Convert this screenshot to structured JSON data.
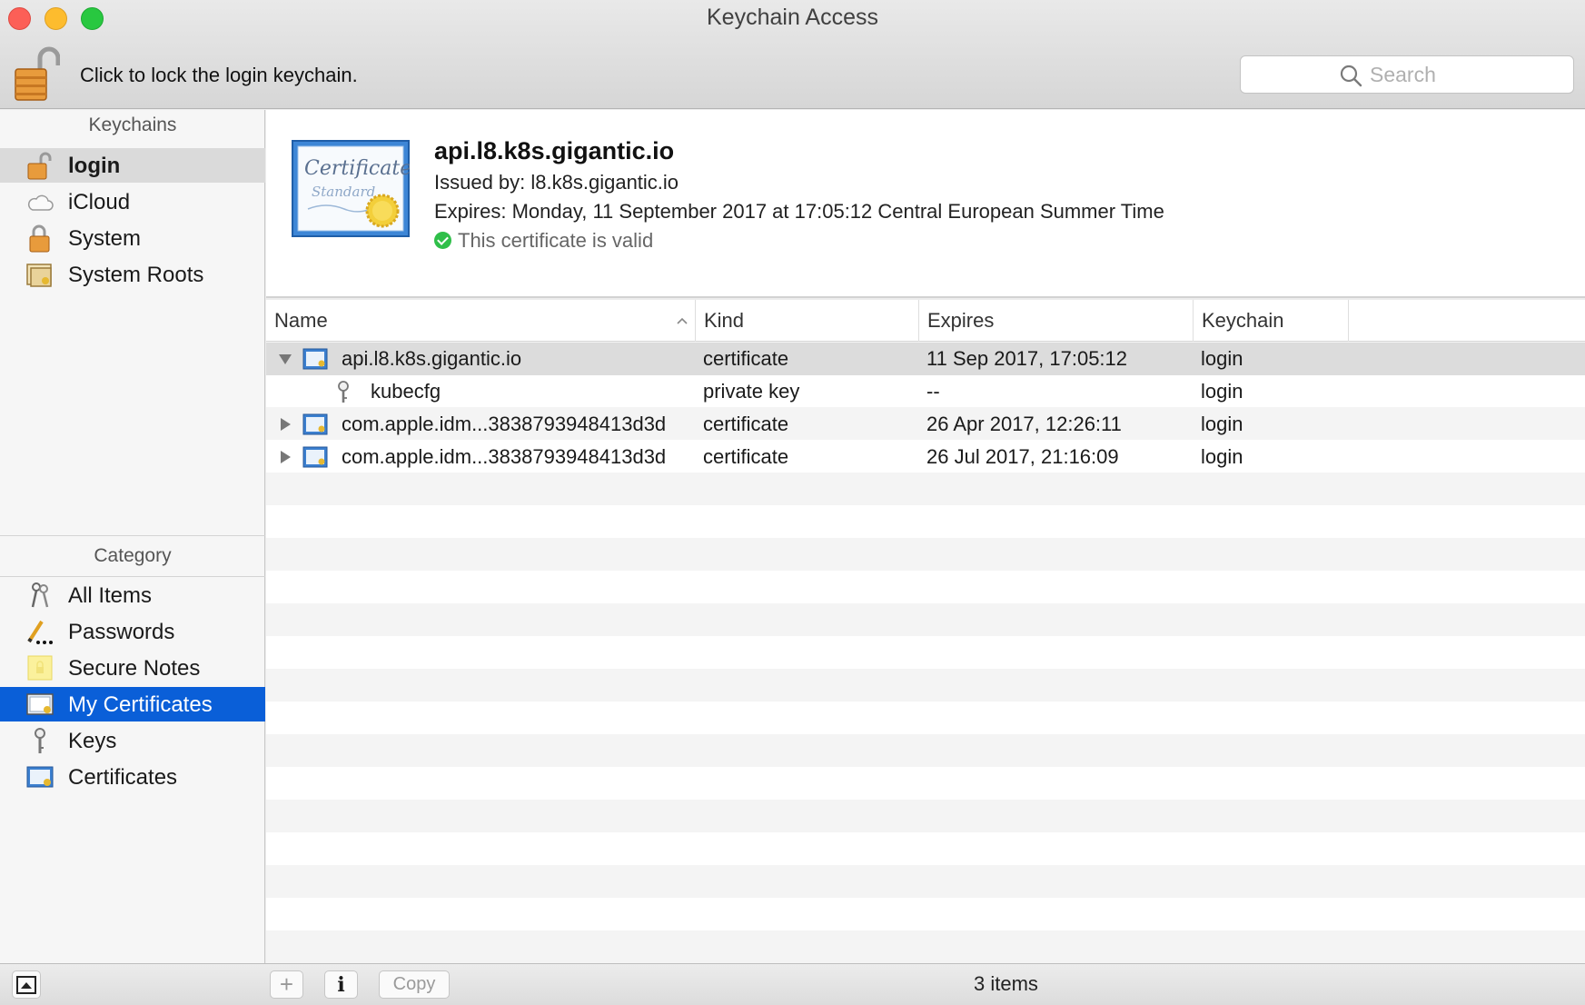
{
  "window": {
    "title": "Keychain Access"
  },
  "toolbar": {
    "lock_label": "Click to lock the login keychain.",
    "search_placeholder": "Search",
    "search_value": ""
  },
  "sidebar": {
    "keychains_header": "Keychains",
    "keychains": [
      {
        "label": "login",
        "icon": "unlocked-padlock-icon"
      },
      {
        "label": "iCloud",
        "icon": "cloud-icon"
      },
      {
        "label": "System",
        "icon": "padlock-icon"
      },
      {
        "label": "System Roots",
        "icon": "certificate-icon"
      }
    ],
    "category_header": "Category",
    "categories": [
      {
        "label": "All Items",
        "icon": "keys-icon"
      },
      {
        "label": "Passwords",
        "icon": "password-pencil-icon"
      },
      {
        "label": "Secure Notes",
        "icon": "secure-note-icon"
      },
      {
        "label": "My Certificates",
        "icon": "my-certificate-icon"
      },
      {
        "label": "Keys",
        "icon": "key-icon"
      },
      {
        "label": "Certificates",
        "icon": "certificate-icon"
      }
    ],
    "selected_keychain": "login",
    "selected_category": "My Certificates"
  },
  "detail": {
    "badge_line1": "Certificate",
    "badge_line2": "Standard",
    "title": "api.l8.k8s.gigantic.io",
    "issued_by": "Issued by: l8.k8s.gigantic.io",
    "expires": "Expires: Monday, 11 September 2017 at 17:05:12 Central European Summer Time",
    "status": "This certificate is valid"
  },
  "table": {
    "columns": [
      "Name",
      "Kind",
      "Expires",
      "Keychain"
    ],
    "rows": [
      {
        "name": "api.l8.k8s.gigantic.io",
        "kind": "certificate",
        "expires": "11 Sep 2017, 17:05:12",
        "keychain": "login"
      },
      {
        "name": "kubecfg",
        "kind": "private key",
        "expires": "--",
        "keychain": "login"
      },
      {
        "name": "com.apple.idm...3838793948413d3d",
        "kind": "certificate",
        "expires": "26 Apr 2017, 12:26:11",
        "keychain": "login"
      },
      {
        "name": "com.apple.idm...3838793948413d3d",
        "kind": "certificate",
        "expires": "26 Jul 2017, 21:16:09",
        "keychain": "login"
      }
    ]
  },
  "bottombar": {
    "add_label": "+",
    "info_label": "i",
    "copy_label": "Copy",
    "status": "3 items"
  },
  "colors": {
    "selection_blue": "#0a5fd8",
    "valid_green": "#2fbf49"
  }
}
